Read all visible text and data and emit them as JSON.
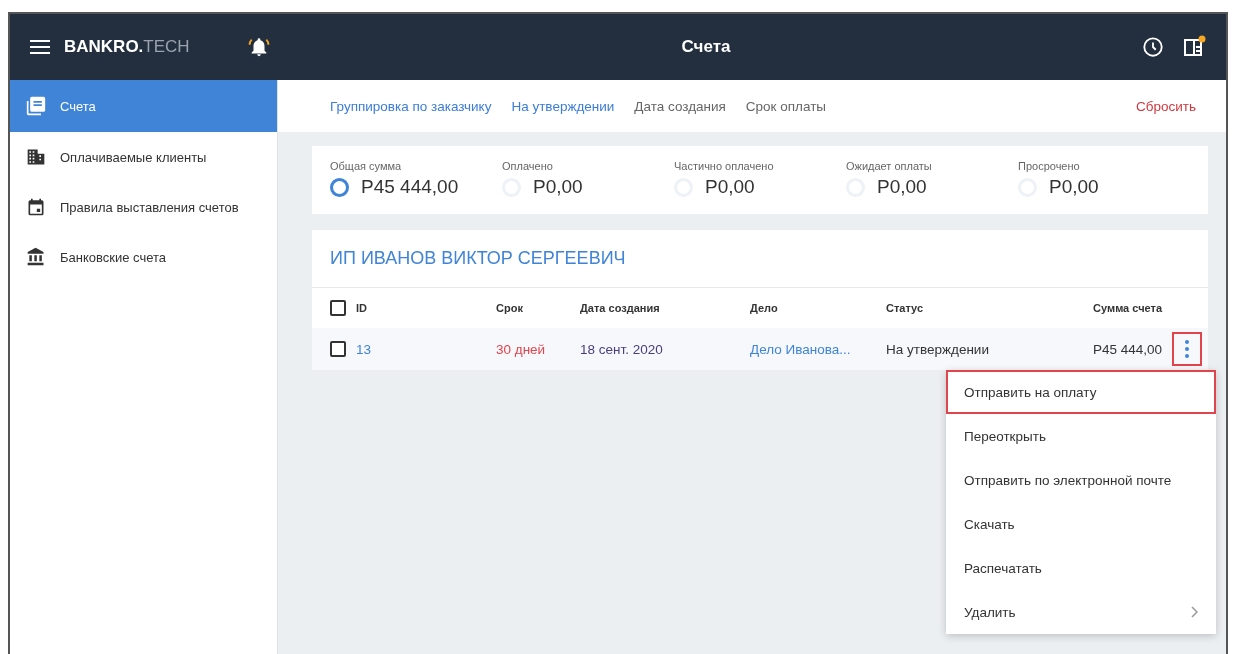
{
  "header": {
    "brand_bold": "BANKRO.",
    "brand_light": "TECH",
    "title": "Счета",
    "panel_badge": true
  },
  "sidebar": {
    "items": [
      {
        "label": "Счета",
        "selected": true
      },
      {
        "label": "Оплачиваемые клиенты",
        "selected": false
      },
      {
        "label": "Правила выставления счетов",
        "selected": false
      },
      {
        "label": "Банковские счета",
        "selected": false
      }
    ]
  },
  "filters": {
    "items": [
      {
        "label": "Группировка по заказчику",
        "active": true
      },
      {
        "label": "На утверждении",
        "active": true
      },
      {
        "label": "Дата создания",
        "active": false
      },
      {
        "label": "Срок оплаты",
        "active": false
      }
    ],
    "reset": "Сбросить"
  },
  "summary": [
    {
      "label": "Общая сумма",
      "value": "P45 444,00",
      "selected": true
    },
    {
      "label": "Оплачено",
      "value": "P0,00",
      "selected": false
    },
    {
      "label": "Частично оплачено",
      "value": "P0,00",
      "selected": false
    },
    {
      "label": "Ожидает оплаты",
      "value": "P0,00",
      "selected": false
    },
    {
      "label": "Просрочено",
      "value": "P0,00",
      "selected": false
    }
  ],
  "group": {
    "title": "ИП ИВАНОВ ВИКТОР СЕРГЕЕВИЧ",
    "header_checked": false,
    "columns": [
      "ID",
      "Срок",
      "Дата создания",
      "Дело",
      "Статус",
      "Сумма счета"
    ],
    "rows": [
      {
        "checked": false,
        "id": "13",
        "term": "30 дней",
        "created": "18 сент. 2020",
        "case": "Дело Иванова...",
        "status": "На утверждении",
        "amount": "P45 444,00",
        "menu_highlighted": true
      }
    ]
  },
  "menu": {
    "items": [
      {
        "label": "Отправить на оплату",
        "highlighted": true,
        "submenu": false
      },
      {
        "label": "Переоткрыть",
        "highlighted": false,
        "submenu": false
      },
      {
        "label": "Отправить по электронной почте",
        "highlighted": false,
        "submenu": false
      },
      {
        "label": "Скачать",
        "highlighted": false,
        "submenu": false
      },
      {
        "label": "Распечатать",
        "highlighted": false,
        "submenu": false
      },
      {
        "label": "Удалить",
        "highlighted": false,
        "submenu": true
      }
    ]
  }
}
